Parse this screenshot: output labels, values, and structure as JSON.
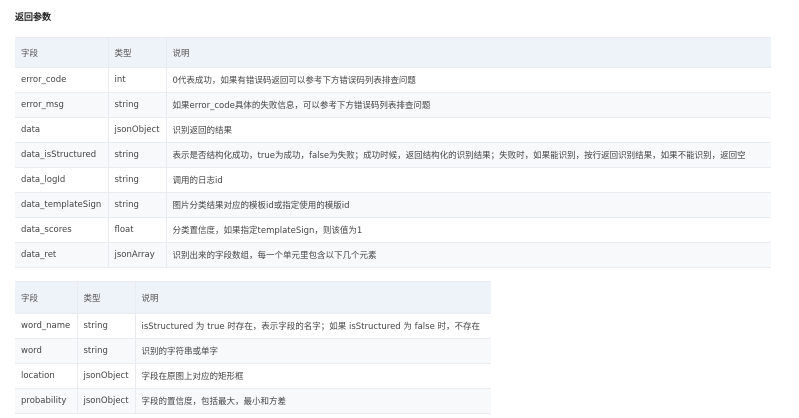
{
  "section_title": "返回参数",
  "table1": {
    "headers": [
      "字段",
      "类型",
      "说明"
    ],
    "rows": [
      [
        "error_code",
        "int",
        "0代表成功，如果有错误码返回可以参考下方错误码列表排查问题"
      ],
      [
        "error_msg",
        "string",
        "如果error_code具体的失败信息，可以参考下方错误码列表排查问题"
      ],
      [
        "data",
        "jsonObject",
        "识别返回的结果"
      ],
      [
        "data_isStructured",
        "string",
        "表示是否结构化成功，true为成功，false为失败；成功时候，返回结构化的识别结果；失败时，如果能识别，按行返回识别结果，如果不能识别，返回空"
      ],
      [
        "data_logId",
        "string",
        "调用的日志id"
      ],
      [
        "data_templateSign",
        "string",
        "图片分类结果对应的模板id或指定使用的模版id"
      ],
      [
        "data_scores",
        "float",
        "分类置信度，如果指定templateSign，则该值为1"
      ],
      [
        "data_ret",
        "jsonArray",
        "识别出来的字段数组，每一个单元里包含以下几个元素"
      ]
    ]
  },
  "table2": {
    "headers": [
      "字段",
      "类型",
      "说明"
    ],
    "rows": [
      [
        "word_name",
        "string",
        "isStructured 为 true 时存在，表示字段的名字；如果 isStructured 为 false 时，不存在"
      ],
      [
        "word",
        "string",
        "识别的字符串或单字"
      ],
      [
        "location",
        "jsonObject",
        "字段在原图上对应的矩形框"
      ],
      [
        "probability",
        "jsonObject",
        "字段的置信度，包括最大，最小和方差"
      ]
    ]
  }
}
